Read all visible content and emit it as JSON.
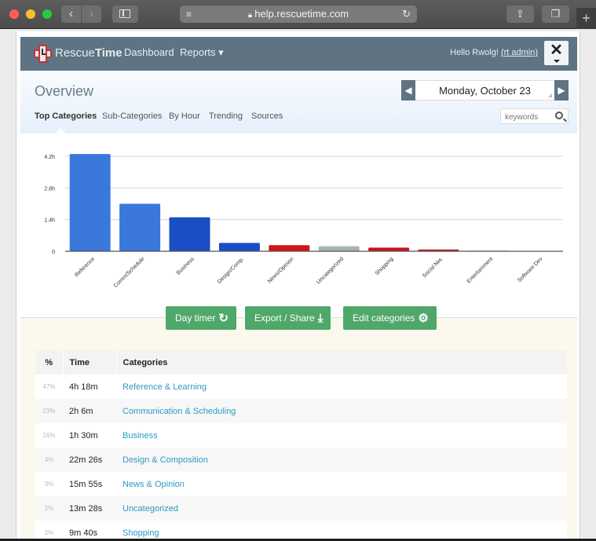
{
  "browser": {
    "url": "help.rescuetime.com",
    "icons": {
      "back": "chevron-left-icon",
      "forward": "chevron-right-icon",
      "sidebar": "sidebar-icon",
      "reader": "reader-icon",
      "lock": "lock-icon",
      "reload": "reload-icon",
      "share": "share-icon",
      "tabs": "tabs-icon",
      "new_tab": "plus-icon"
    },
    "glyphs": {
      "back": "‹",
      "forward": "›",
      "reader": "≡",
      "lock": "🔒",
      "reload": "↻",
      "share": "⇪",
      "tabs": "❐",
      "new_tab": "+"
    }
  },
  "header": {
    "brand_light": "Rescue",
    "brand_bold": "Time",
    "nav": [
      {
        "label": "Dashboard"
      },
      {
        "label": "Reports ▾"
      }
    ],
    "greeting": "Hello Rwolg! ",
    "user_link": "(rt admin)",
    "tools_glyph": "✕"
  },
  "subheader": {
    "title": "Overview",
    "date": "Monday, October 23",
    "prev_glyph": "◀",
    "next_glyph": "▶",
    "tabs": [
      {
        "label": "Top Categories",
        "active": true
      },
      {
        "label": "Sub-Categories"
      },
      {
        "label": "By Hour"
      },
      {
        "label": "Trending"
      },
      {
        "label": "Sources"
      }
    ],
    "search_placeholder": "keywords"
  },
  "chart_data": {
    "type": "bar",
    "title": "",
    "xlabel": "",
    "ylabel": "",
    "categories": [
      "Reference",
      "Comm/Schedule",
      "Business",
      "Design/Comp.",
      "News/Opinion",
      "Uncategorized",
      "Shopping",
      "Social Net.",
      "Entertainment",
      "Software Dev"
    ],
    "values": [
      4.3,
      2.1,
      1.5,
      0.37,
      0.27,
      0.22,
      0.16,
      0.08,
      0.02,
      0.01
    ],
    "colors": [
      "#3a78dc",
      "#3a78dc",
      "#1a4ec4",
      "#1a4ec4",
      "#d4121b",
      "#a9b4b5",
      "#c8121b",
      "#c8121b",
      "#c8121b",
      "#c8121b"
    ],
    "yticks": [
      0,
      1.4,
      2.8,
      4.2
    ],
    "ytick_labels": [
      "0",
      "1.4h",
      "2.8h",
      "4.2h"
    ],
    "ylim": [
      0,
      4.2
    ],
    "grid": true,
    "legend": "none"
  },
  "actions": [
    {
      "label": "Day timer",
      "icon": "refresh-arrow-icon",
      "glyph": "↻"
    },
    {
      "label": "Export / Share",
      "icon": "export-share-icon",
      "glyph": "⤓"
    },
    {
      "label": "Edit categories",
      "icon": "gear-icon",
      "glyph": "⚙"
    }
  ],
  "table": {
    "headers": {
      "pct": "%",
      "time": "Time",
      "category": "Categories"
    },
    "rows": [
      {
        "pct": "47%",
        "time": "4h 18m",
        "category": "Reference & Learning"
      },
      {
        "pct": "23%",
        "time": "2h 6m",
        "category": "Communication & Scheduling"
      },
      {
        "pct": "16%",
        "time": "1h 30m",
        "category": "Business"
      },
      {
        "pct": "4%",
        "time": "22m 26s",
        "category": "Design & Composition"
      },
      {
        "pct": "3%",
        "time": "15m 55s",
        "category": "News & Opinion"
      },
      {
        "pct": "2%",
        "time": "13m 28s",
        "category": "Uncategorized"
      },
      {
        "pct": "2%",
        "time": "9m 40s",
        "category": "Shopping"
      }
    ]
  }
}
